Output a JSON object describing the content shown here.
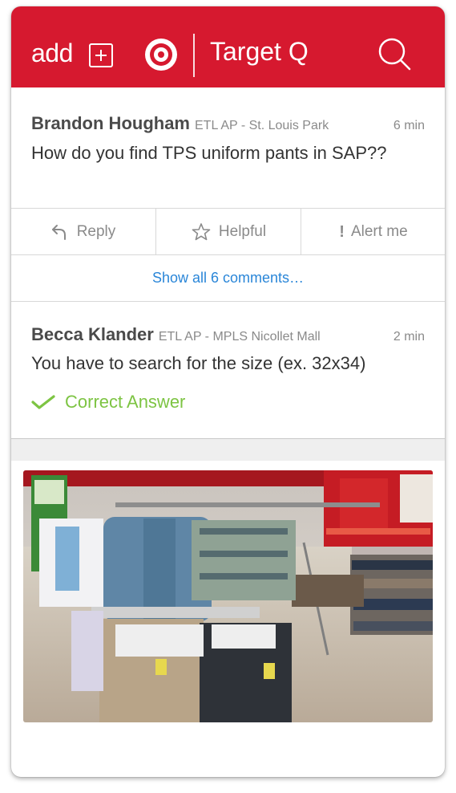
{
  "header": {
    "add_label": "add",
    "title": "Target Q",
    "brand_color": "#d6192f",
    "icons": [
      "plus-box-icon",
      "target-logo",
      "search-icon"
    ]
  },
  "question": {
    "author": "Brandon Hougham",
    "meta": "ETL AP - St. Louis Park",
    "time": "6 min",
    "text": "How do you find TPS uniform pants in SAP??"
  },
  "actions": [
    {
      "label": "Reply",
      "icon": "reply-arrow-icon"
    },
    {
      "label": "Helpful",
      "icon": "star-icon"
    },
    {
      "label": "Alert me",
      "icon": "exclamation-icon"
    }
  ],
  "show_comments": "Show all 6 comments…",
  "answer": {
    "author": "Becca Klander",
    "meta": "ETL AP - MPLS Nicollet Mall",
    "time": "2 min",
    "text": "You have to search for the size (ex. 32x34)",
    "badge": "Correct Answer",
    "badge_color": "#7dc443"
  },
  "link_color": "#2a86d8"
}
